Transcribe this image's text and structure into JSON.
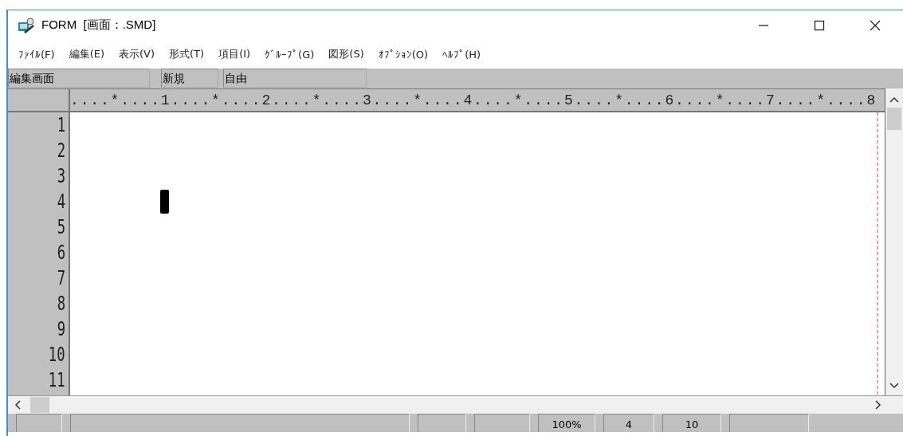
{
  "window": {
    "title": "FORM  [画面：.SMD]"
  },
  "menu": [
    "ﾌｧｲﾙ(F)",
    "編集(E)",
    "表示(V)",
    "形式(T)",
    "項目(I)",
    "ｸﾞﾙｰﾌﾟ(G)",
    "図形(S)",
    "ｵﾌﾟｼｮﾝ(O)",
    "ﾍﾙﾌﾟ(H)"
  ],
  "info_bar": [
    "編集画面",
    "新規",
    "自由"
  ],
  "ruler": "....*....1....*....2....*....3....*....4....*....5....*....6....*....7....*....8",
  "line_numbers": [
    "1",
    "2",
    "3",
    "4",
    "5",
    "6",
    "7",
    "8",
    "9",
    "10",
    "11"
  ],
  "status_bar": [
    "100%",
    "4",
    "10"
  ]
}
